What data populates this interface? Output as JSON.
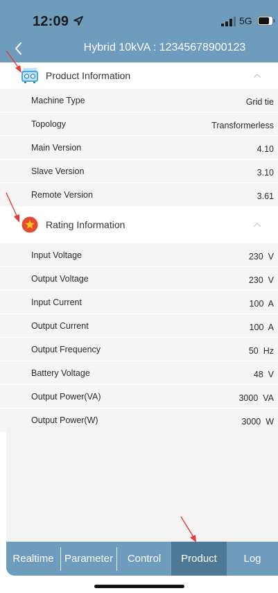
{
  "status_bar": {
    "time": "12:09",
    "network": "5G",
    "location_icon": "location-arrow-icon",
    "signal_icon": "signal-bars-icon",
    "battery_icon": "battery-icon"
  },
  "header": {
    "back_icon": "chevron-left-icon",
    "title": "Hybrid 10kVA : 12345678900123",
    "background_color": "#6f9bbd"
  },
  "sections": [
    {
      "title": "Product Information",
      "icon": "inverter-device-icon",
      "expanded": true,
      "rows": [
        {
          "label": "Machine Type",
          "value": "Grid tie"
        },
        {
          "label": "Topology",
          "value": "Transformerless"
        },
        {
          "label": "Main Version",
          "value": "4.10"
        },
        {
          "label": "Slave Version",
          "value": "3.10"
        },
        {
          "label": "Remote Version",
          "value": "3.61"
        }
      ]
    },
    {
      "title": "Rating Information",
      "icon": "star-badge-icon",
      "expanded": true,
      "rows": [
        {
          "label": "Input Voltage",
          "value": "230  V"
        },
        {
          "label": "Output Voltage",
          "value": "230  V"
        },
        {
          "label": "Input Current",
          "value": "100  A"
        },
        {
          "label": "Output Current",
          "value": "100  A"
        },
        {
          "label": "Output Frequency",
          "value": "50  Hz"
        },
        {
          "label": "Battery Voltage",
          "value": "48  V"
        },
        {
          "label": "Output Power(VA)",
          "value": "3000  VA"
        },
        {
          "label": "Output Power(W)",
          "value": "3000  W"
        }
      ]
    }
  ],
  "tabs": [
    {
      "label": "Realtime",
      "active": false
    },
    {
      "label": "Parameter",
      "active": false
    },
    {
      "label": "Control",
      "active": false
    },
    {
      "label": "Product",
      "active": true
    },
    {
      "label": "Log",
      "active": false
    }
  ],
  "colors": {
    "accent": "#6f9bbd",
    "active_tab": "#4e7996",
    "row_background": "#f5f5f5",
    "annotation_arrow": "#e53935"
  }
}
